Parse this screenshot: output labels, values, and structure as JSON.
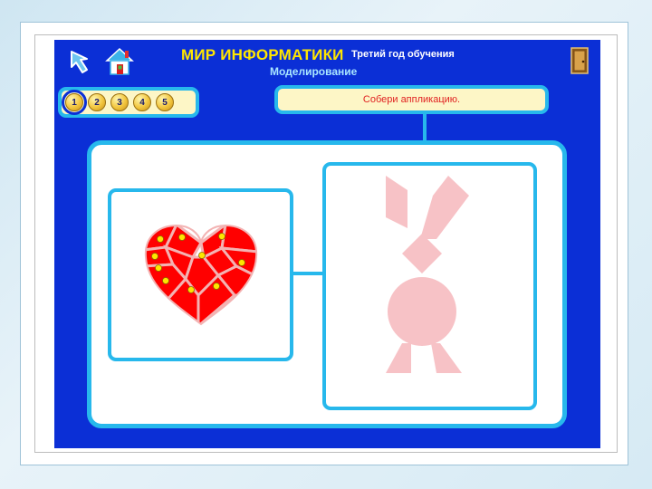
{
  "header": {
    "title": "МИР ИНФОРМАТИКИ",
    "year": "Третий год обучения",
    "section": "Моделирование"
  },
  "levels": [
    {
      "label": "1",
      "active": true
    },
    {
      "label": "2",
      "active": false
    },
    {
      "label": "3",
      "active": false
    },
    {
      "label": "4",
      "active": false
    },
    {
      "label": "5",
      "active": false
    }
  ],
  "instruction": "Собери аппликацию.",
  "colors": {
    "app_background": "#0b2fd6",
    "frame_border": "#27b8ec",
    "panel_fill": "#fdf6c6",
    "title": "#ffe600",
    "piece_red": "#ff0000",
    "silhouette_pink": "#f7c2c6"
  },
  "icons": {
    "back": "arrow-pointer-icon",
    "home": "house-icon",
    "exit": "door-icon"
  }
}
